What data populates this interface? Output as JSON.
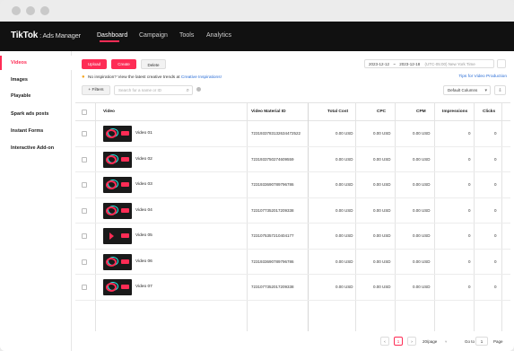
{
  "app": {
    "logo": "TikTok",
    "logo_sub": ": Ads Manager",
    "nav": [
      "Dashboard",
      "Campaign",
      "Tools",
      "Analytics"
    ]
  },
  "sidebar": {
    "items": [
      "Videos",
      "Images",
      "Playable",
      "Spark ads posts",
      "Instant Forms",
      "Interactive Add-on"
    ]
  },
  "toolbar": {
    "upload": "Upload",
    "create": "Create",
    "delete": "Delete",
    "date_from": "2023-12-12",
    "date_sep": "~",
    "date_to": "2023-12-18",
    "timezone": "(UTC-05:00) New York Time"
  },
  "banner": {
    "text": "No inspiration? View the latest creative trends at",
    "link": "Creative Inspirations!",
    "tips": "Tips for Video Production"
  },
  "filters": {
    "filters_label": "+ Filters",
    "search_placeholder": "Search for a name or ID",
    "columns_label": "Default Columns"
  },
  "table": {
    "headers": {
      "video": "Video",
      "material_id": "Video Material ID",
      "total_cost": "Total Cost",
      "cpc": "CPC",
      "cpm": "CPM",
      "impressions": "Impressions",
      "clicks": "Clicks"
    },
    "rows": [
      {
        "name": "Video 01",
        "id": "7231933783132634472522",
        "cost": "0.00 USD",
        "cpc": "0.00 USD",
        "cpm": "0.00 USD",
        "impressions": "0",
        "clicks": "0",
        "thumb": "logo"
      },
      {
        "name": "Video 02",
        "id": "7231933750274609559",
        "cost": "0.00 USD",
        "cpc": "0.00 USD",
        "cpm": "0.00 USD",
        "impressions": "0",
        "clicks": "0",
        "thumb": "logo"
      },
      {
        "name": "Video 03",
        "id": "7231933690789796786",
        "cost": "0.00 USD",
        "cpc": "0.00 USD",
        "cpm": "0.00 USD",
        "impressions": "0",
        "clicks": "0",
        "thumb": "logo"
      },
      {
        "name": "Video 04",
        "id": "7231077352017209338",
        "cost": "0.00 USD",
        "cpc": "0.00 USD",
        "cpm": "0.00 USD",
        "impressions": "0",
        "clicks": "0",
        "thumb": "logo"
      },
      {
        "name": "Video 05",
        "id": "7231075357210404177",
        "cost": "0.00 USD",
        "cpc": "0.00 USD",
        "cpm": "0.00 USD",
        "impressions": "0",
        "clicks": "0",
        "thumb": "play"
      },
      {
        "name": "Video 06",
        "id": "7231933690789796786",
        "cost": "0.00 USD",
        "cpc": "0.00 USD",
        "cpm": "0.00 USD",
        "impressions": "0",
        "clicks": "0",
        "thumb": "logo"
      },
      {
        "name": "Video 07",
        "id": "7231077352017209338",
        "cost": "0.00 USD",
        "cpc": "0.00 USD",
        "cpm": "0.00 USD",
        "impressions": "0",
        "clicks": "0",
        "thumb": "logo"
      }
    ]
  },
  "pagination": {
    "prev": "‹",
    "current": "1",
    "next": "›",
    "per_page": "20/page",
    "goto_label": "Go to",
    "goto_value": "1",
    "page_label": "Page"
  },
  "colors": {
    "accent": "#fe2c55",
    "cyan": "#25f4ee",
    "link": "#2a6dd6",
    "topbar": "#111111"
  }
}
